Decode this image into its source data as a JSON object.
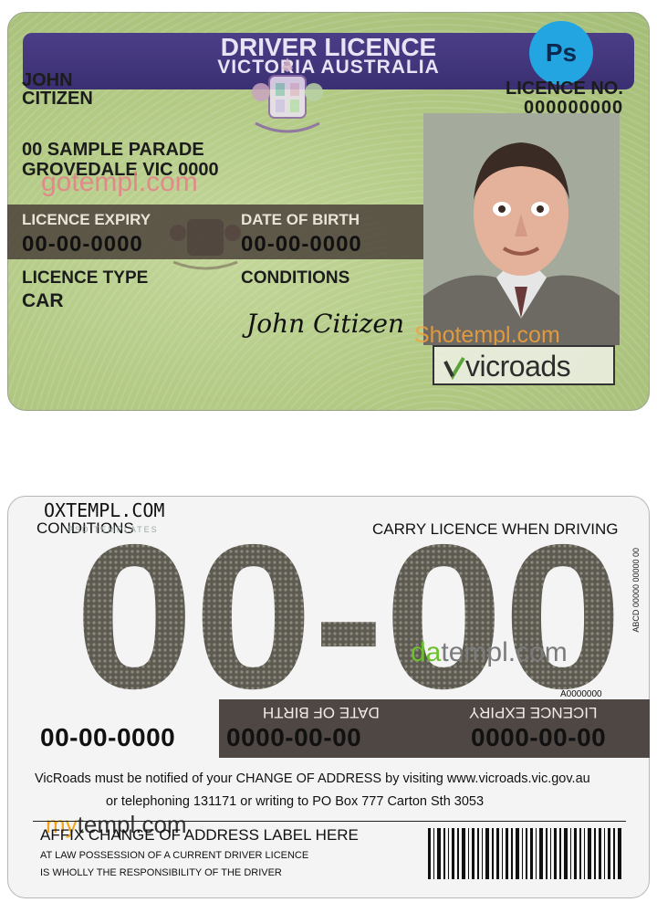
{
  "front": {
    "title": "DRIVER LICENCE",
    "subtitle": "VICTORIA AUSTRALIA",
    "ps_badge": "Ps",
    "name_line1": "JOHN",
    "name_line2": "CITIZEN",
    "licence_no_label": "LICENCE NO.",
    "licence_no": "000000000",
    "address_line1": "00 SAMPLE PARADE",
    "address_line2": "GROVEDALE VIC 0000",
    "watermark": "gotempl.com",
    "licence_expiry_label": "LICENCE EXPIRY",
    "licence_expiry": "00-00-0000",
    "dob_label": "DATE OF BIRTH",
    "dob": "00-00-0000",
    "licence_type_label": "LICENCE TYPE",
    "licence_type": "CAR",
    "conditions_label": "CONDITIONS",
    "signature": "John Citizen",
    "photo_watermark": "Shotempl.com",
    "vicroads_logo": "vicroads"
  },
  "back": {
    "oxtempl": "OXTEMPL.COM",
    "oxtempl_sub": "PSD TEMPLATES",
    "conditions_label": "CONDITIONS",
    "carry_notice": "CARRY LICENCE WHEN DRIVING",
    "big_conditions": "00-00",
    "vertical_serial": "ABCD 00000 00000 00",
    "watermark_da": "da",
    "watermark_rest": "templ.com",
    "a_code": "A0000000",
    "dob_label_mirrored_1": "DATE OF BIRTH",
    "expiry_label_mirrored": "LICENCE EXPIRY",
    "dob_back": "0000-00-00",
    "expiry_back": "0000-00-00",
    "left_date": "00-00-0000",
    "notice_line1": "VicRoads must be notified of your CHANGE OF ADDRESS by visiting www.vicroads.vic.gov.au",
    "notice_line2": "or telephoning 131171 or writing to PO Box 777 Carton Sth 3053",
    "watermark_my": "my",
    "watermark_my_rest": "templ.com",
    "affix_label": "AFFIX CHANGE OF ADDRESS LABEL HERE",
    "law_line1": "AT LAW POSSESSION OF A CURRENT DRIVER LICENCE",
    "law_line2": "IS WHOLLY THE RESPONSIBILITY OF THE DRIVER"
  },
  "colors": {
    "card_green": "#b3ca85",
    "title_band": "#3b2f73",
    "ps_blue": "#22a5e0",
    "back_band": "#4f4744"
  },
  "icons": [
    "crest-icon",
    "vicroads-check-icon",
    "barcode-icon",
    "photo-portrait"
  ]
}
